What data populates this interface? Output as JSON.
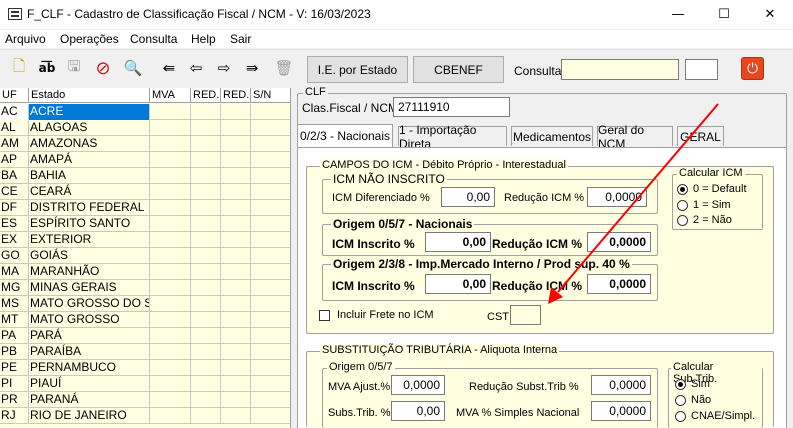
{
  "window": {
    "title": "F_CLF - Cadastro de Classificação Fiscal / NCM - V: 16/03/2023",
    "minimize_glyph": "—",
    "maximize_glyph": "☐",
    "close_glyph": "✕"
  },
  "menu": [
    "Arquivo",
    "Operações",
    "Consulta",
    "Help",
    "Sair"
  ],
  "toolbar": {
    "icons": [
      "new-document-icon",
      "abc-edit-icon",
      "save-icon",
      "cancel-icon",
      "search-icon",
      "first-record-icon",
      "previous-record-icon",
      "next-record-icon",
      "last-record-icon",
      "delete-trash-icon"
    ],
    "icon_glyphs": [
      "🗋",
      "a͞b",
      "🖫",
      "⊘",
      "🔍",
      "⇚",
      "⇦",
      "⇨",
      "⇛",
      "🗑"
    ],
    "ie_estado_label": "I.E. por Estado",
    "cbenef_label": "CBENEF",
    "consulta_label": "Consulta",
    "consulta_value": "",
    "consulta_extra_value": "",
    "exit_glyph": "⏻",
    "colors": {
      "exit_bg": "#e8461f",
      "selection": "#0078d7",
      "grid_bg": "#ffffe1",
      "arrow": "#ff0000"
    }
  },
  "grid": {
    "columns": [
      "UF",
      "Estado",
      "MVA",
      "RED.",
      "RED.",
      "S/N"
    ],
    "rows": [
      {
        "uf": "AC",
        "estado": "ACRE",
        "selected": true
      },
      {
        "uf": "AL",
        "estado": "ALAGOAS"
      },
      {
        "uf": "AM",
        "estado": "AMAZONAS"
      },
      {
        "uf": "AP",
        "estado": "AMAPÁ"
      },
      {
        "uf": "BA",
        "estado": "BAHIA"
      },
      {
        "uf": "CE",
        "estado": "CEARÁ"
      },
      {
        "uf": "DF",
        "estado": "DISTRITO FEDERAL"
      },
      {
        "uf": "ES",
        "estado": "ESPÍRITO SANTO"
      },
      {
        "uf": "EX",
        "estado": "EXTERIOR"
      },
      {
        "uf": "GO",
        "estado": "GOIÁS"
      },
      {
        "uf": "MA",
        "estado": "MARANHÃO"
      },
      {
        "uf": "MG",
        "estado": "MINAS GERAIS"
      },
      {
        "uf": "MS",
        "estado": "MATO GROSSO DO SUL"
      },
      {
        "uf": "MT",
        "estado": "MATO GROSSO"
      },
      {
        "uf": "PA",
        "estado": "PARÁ"
      },
      {
        "uf": "PB",
        "estado": "PARAÍBA"
      },
      {
        "uf": "PE",
        "estado": "PERNAMBUCO"
      },
      {
        "uf": "PI",
        "estado": "PIAUÍ"
      },
      {
        "uf": "PR",
        "estado": "PARANÁ"
      },
      {
        "uf": "RJ",
        "estado": "RIO DE JANEIRO"
      }
    ]
  },
  "clf": {
    "group_title": "CLF",
    "ncm_label": "Clas.Fiscal / NCM",
    "ncm_value": "27111910",
    "tabs": [
      "0/2/3 - Nacionais",
      "1 - Importação Direta",
      "Medicamentos",
      "Geral do NCM",
      "GERAL"
    ],
    "active_tab": 0,
    "icm": {
      "title": "CAMPOS DO ICM - Débito Próprio - Interestadual",
      "nao_inscrito": {
        "title": "ICM NÃO INSCRITO",
        "diferenciado_label": "ICM Diferenciado %",
        "diferenciado_value": "0,00",
        "reducao_label": "Redução ICM %",
        "reducao_value": "0,0000"
      },
      "origem_nacionais": {
        "title": "Origem 0/5/7 - Nacionais",
        "inscrito_label": "ICM Inscrito %",
        "inscrito_value": "0,00",
        "reducao_label": "Redução ICM %",
        "reducao_value": "0,0000"
      },
      "origem_importado": {
        "title": "Origem 2/3/8 - Imp.Mercado Interno / Prod sup. 40 %",
        "inscrito_label": "ICM Inscrito %",
        "inscrito_value": "0,00",
        "reducao_label": "Redução ICM %",
        "reducao_value": "0,0000"
      },
      "frete_label": "Incluir Frete no ICM",
      "frete_checked": false,
      "cst_label": "CST",
      "cst_value": "",
      "calcular": {
        "title": "Calcular ICM",
        "options": [
          "0 = Default",
          "1 = Sim",
          "2 = Não"
        ],
        "selected": 0
      }
    },
    "st": {
      "title": "SUBSTITUIÇÃO TRIBUTÁRIA - Aliquota Interna",
      "origem": {
        "title": "Origem 0/5/7",
        "mva_label": "MVA Ajust.%",
        "mva_value": "0,0000",
        "reducao_label": "Redução Subst.Trib %",
        "reducao_value": "0,0000",
        "subs_label": "Subs.Trib. %",
        "subs_value": "0,00",
        "mva_simples_label": "MVA % Simples Nacional",
        "mva_simples_value": "0,0000"
      },
      "calcular": {
        "title": "Calcular Sub.Trib.",
        "options": [
          "Sim",
          "Não",
          "CNAE/Simpl."
        ],
        "selected": 0
      }
    }
  }
}
